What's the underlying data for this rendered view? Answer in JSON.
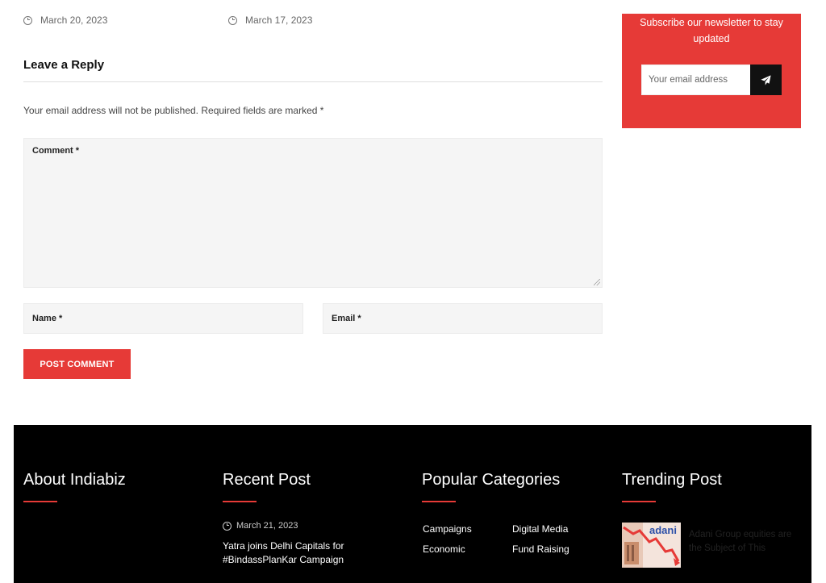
{
  "post_nav": {
    "prev_date": "March 20, 2023",
    "next_date": "March 17, 2023"
  },
  "reply": {
    "title": "Leave a Reply",
    "note": "Your email address will not be published. Required fields are marked *",
    "comment_label": "Comment *",
    "name_label": "Name *",
    "email_label": "Email *",
    "submit_label": "POST COMMENT"
  },
  "newsletter": {
    "text": "Subscribe our newsletter to stay updated",
    "input_placeholder": "Your email address",
    "submit_icon": "paper-plane-icon"
  },
  "footer": {
    "about_heading": "About Indiabiz",
    "recent_heading": "Recent Post",
    "recent_post": {
      "date": "March 21, 2023",
      "title": "Yatra joins Delhi Capitals for #BindassPlanKar Campaign"
    },
    "categories_heading": "Popular Categories",
    "categories": [
      "Campaigns",
      "Digital Media",
      "Economic",
      "Fund Raising"
    ],
    "trending_heading": "Trending Post",
    "trending_post": {
      "title": "Adani Group equities are the Subject of This",
      "thumb_text": "adani"
    }
  },
  "colors": {
    "accent": "#e63a37",
    "footer_bg": "#000000",
    "field_bg": "#f5f5f5"
  }
}
